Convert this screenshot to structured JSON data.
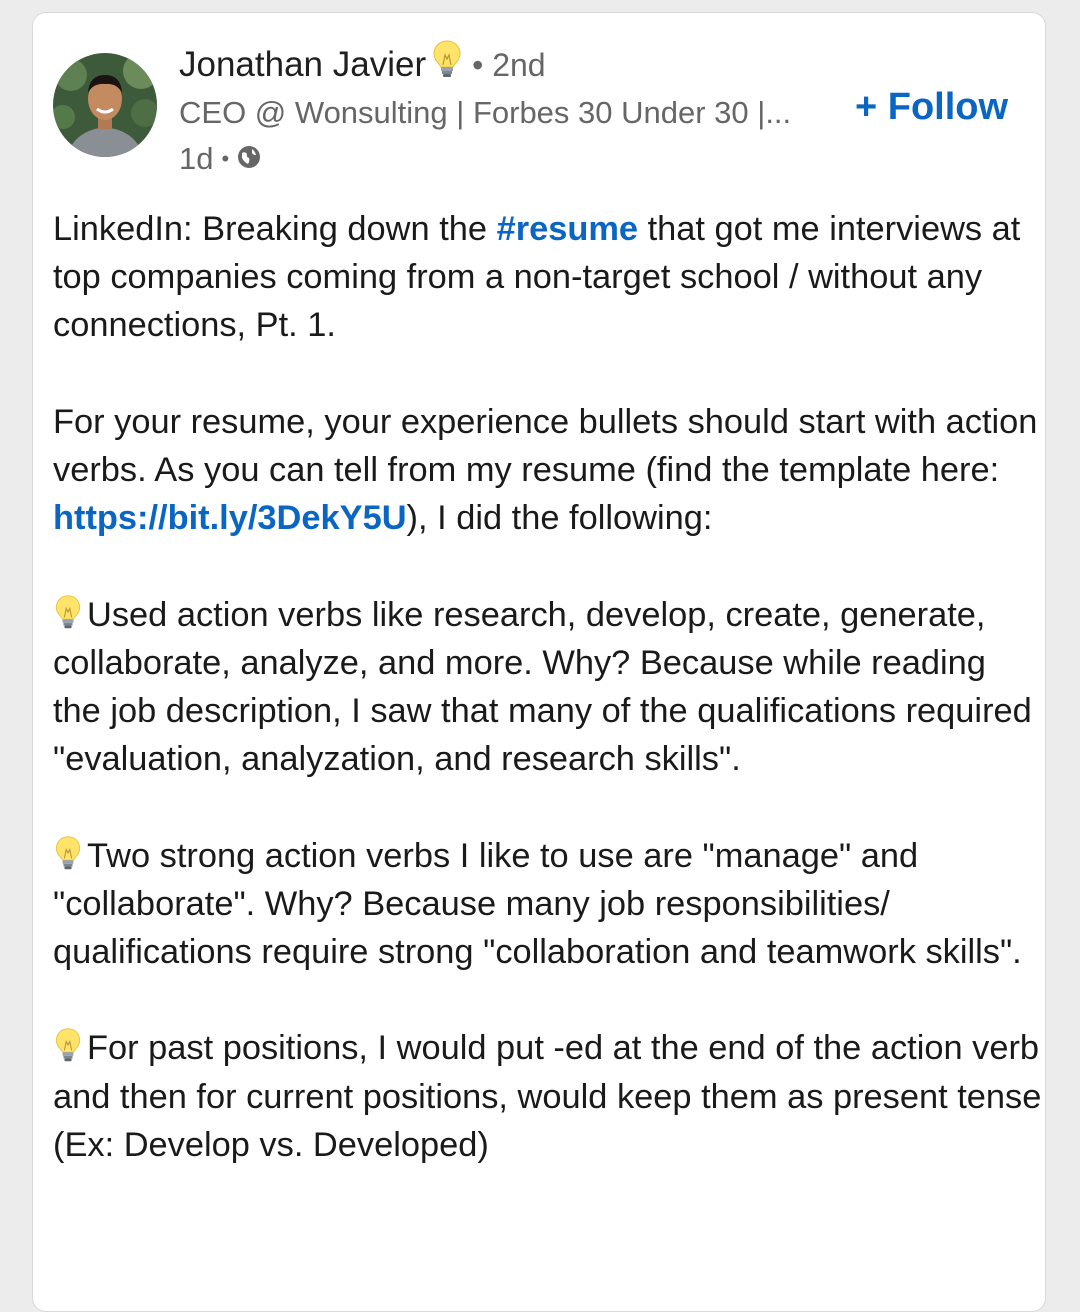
{
  "author": {
    "name": "Jonathan Javier",
    "degree": "2nd",
    "headline": "CEO @ Wonsulting | Forbes 30 Under 30 |...",
    "time": "1d",
    "visibility_icon": "globe-icon"
  },
  "follow_label": "+ Follow",
  "post": {
    "p1_a": "LinkedIn: Breaking down the ",
    "p1_hashtag": "#resume",
    "p1_b": " that got me interviews at top companies coming from a non-target school / without any connections, Pt. 1.",
    "p2_a": "For your resume, your experience bullets should start with action verbs. As you can tell from my resume (find the template here: ",
    "p2_link": "https://bit.ly/3DekY5U",
    "p2_b": "), I did the following:",
    "bullet1": "Used action verbs like research, develop, create, generate, collaborate, analyze, and more. Why? Because while reading the job description, I saw that many of the qualifications required \"evaluation, analyzation, and research skills\".",
    "bullet2": "Two strong action verbs I like to use are \"manage\" and \"collaborate\". Why? Because many job responsibilities/ qualifications require strong \"collaboration and teamwork skills\".",
    "bullet3": "For past positions, I would put -ed at the end of the action verb and then for current positions, would keep them as present tense (Ex: Develop vs. Developed)",
    "bullet_icon": "lightbulb-icon"
  },
  "colors": {
    "link": "#0a66c2",
    "text": "#1a1a1a",
    "muted": "#666666"
  }
}
